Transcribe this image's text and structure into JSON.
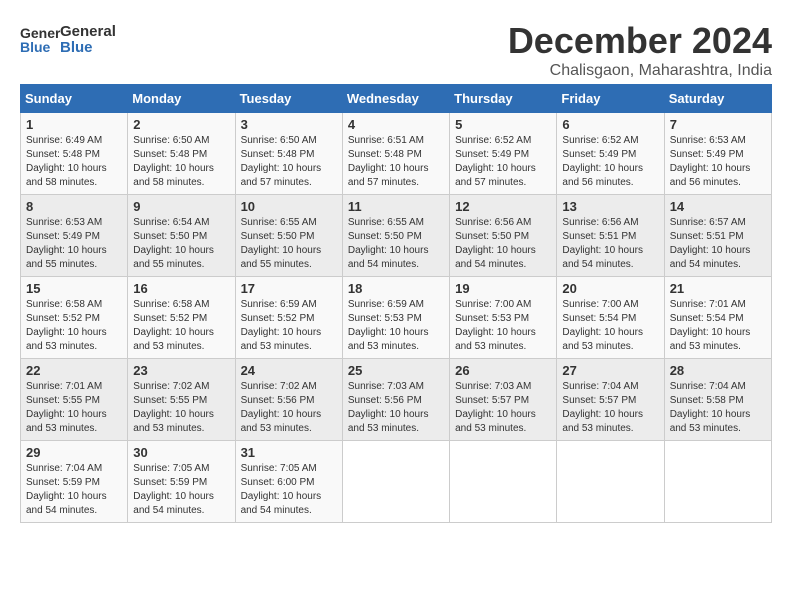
{
  "app": {
    "logo_general": "General",
    "logo_blue": "Blue"
  },
  "calendar": {
    "title": "December 2024",
    "subtitle": "Chalisgaon, Maharashtra, India",
    "headers": [
      "Sunday",
      "Monday",
      "Tuesday",
      "Wednesday",
      "Thursday",
      "Friday",
      "Saturday"
    ],
    "weeks": [
      [
        {
          "day": "1",
          "sunrise": "6:49 AM",
          "sunset": "5:48 PM",
          "daylight": "10 hours and 58 minutes."
        },
        {
          "day": "2",
          "sunrise": "6:50 AM",
          "sunset": "5:48 PM",
          "daylight": "10 hours and 58 minutes."
        },
        {
          "day": "3",
          "sunrise": "6:50 AM",
          "sunset": "5:48 PM",
          "daylight": "10 hours and 57 minutes."
        },
        {
          "day": "4",
          "sunrise": "6:51 AM",
          "sunset": "5:48 PM",
          "daylight": "10 hours and 57 minutes."
        },
        {
          "day": "5",
          "sunrise": "6:52 AM",
          "sunset": "5:49 PM",
          "daylight": "10 hours and 57 minutes."
        },
        {
          "day": "6",
          "sunrise": "6:52 AM",
          "sunset": "5:49 PM",
          "daylight": "10 hours and 56 minutes."
        },
        {
          "day": "7",
          "sunrise": "6:53 AM",
          "sunset": "5:49 PM",
          "daylight": "10 hours and 56 minutes."
        }
      ],
      [
        {
          "day": "8",
          "sunrise": "6:53 AM",
          "sunset": "5:49 PM",
          "daylight": "10 hours and 55 minutes."
        },
        {
          "day": "9",
          "sunrise": "6:54 AM",
          "sunset": "5:50 PM",
          "daylight": "10 hours and 55 minutes."
        },
        {
          "day": "10",
          "sunrise": "6:55 AM",
          "sunset": "5:50 PM",
          "daylight": "10 hours and 55 minutes."
        },
        {
          "day": "11",
          "sunrise": "6:55 AM",
          "sunset": "5:50 PM",
          "daylight": "10 hours and 54 minutes."
        },
        {
          "day": "12",
          "sunrise": "6:56 AM",
          "sunset": "5:50 PM",
          "daylight": "10 hours and 54 minutes."
        },
        {
          "day": "13",
          "sunrise": "6:56 AM",
          "sunset": "5:51 PM",
          "daylight": "10 hours and 54 minutes."
        },
        {
          "day": "14",
          "sunrise": "6:57 AM",
          "sunset": "5:51 PM",
          "daylight": "10 hours and 54 minutes."
        }
      ],
      [
        {
          "day": "15",
          "sunrise": "6:58 AM",
          "sunset": "5:52 PM",
          "daylight": "10 hours and 53 minutes."
        },
        {
          "day": "16",
          "sunrise": "6:58 AM",
          "sunset": "5:52 PM",
          "daylight": "10 hours and 53 minutes."
        },
        {
          "day": "17",
          "sunrise": "6:59 AM",
          "sunset": "5:52 PM",
          "daylight": "10 hours and 53 minutes."
        },
        {
          "day": "18",
          "sunrise": "6:59 AM",
          "sunset": "5:53 PM",
          "daylight": "10 hours and 53 minutes."
        },
        {
          "day": "19",
          "sunrise": "7:00 AM",
          "sunset": "5:53 PM",
          "daylight": "10 hours and 53 minutes."
        },
        {
          "day": "20",
          "sunrise": "7:00 AM",
          "sunset": "5:54 PM",
          "daylight": "10 hours and 53 minutes."
        },
        {
          "day": "21",
          "sunrise": "7:01 AM",
          "sunset": "5:54 PM",
          "daylight": "10 hours and 53 minutes."
        }
      ],
      [
        {
          "day": "22",
          "sunrise": "7:01 AM",
          "sunset": "5:55 PM",
          "daylight": "10 hours and 53 minutes."
        },
        {
          "day": "23",
          "sunrise": "7:02 AM",
          "sunset": "5:55 PM",
          "daylight": "10 hours and 53 minutes."
        },
        {
          "day": "24",
          "sunrise": "7:02 AM",
          "sunset": "5:56 PM",
          "daylight": "10 hours and 53 minutes."
        },
        {
          "day": "25",
          "sunrise": "7:03 AM",
          "sunset": "5:56 PM",
          "daylight": "10 hours and 53 minutes."
        },
        {
          "day": "26",
          "sunrise": "7:03 AM",
          "sunset": "5:57 PM",
          "daylight": "10 hours and 53 minutes."
        },
        {
          "day": "27",
          "sunrise": "7:04 AM",
          "sunset": "5:57 PM",
          "daylight": "10 hours and 53 minutes."
        },
        {
          "day": "28",
          "sunrise": "7:04 AM",
          "sunset": "5:58 PM",
          "daylight": "10 hours and 53 minutes."
        }
      ],
      [
        {
          "day": "29",
          "sunrise": "7:04 AM",
          "sunset": "5:59 PM",
          "daylight": "10 hours and 54 minutes."
        },
        {
          "day": "30",
          "sunrise": "7:05 AM",
          "sunset": "5:59 PM",
          "daylight": "10 hours and 54 minutes."
        },
        {
          "day": "31",
          "sunrise": "7:05 AM",
          "sunset": "6:00 PM",
          "daylight": "10 hours and 54 minutes."
        },
        null,
        null,
        null,
        null
      ]
    ]
  }
}
